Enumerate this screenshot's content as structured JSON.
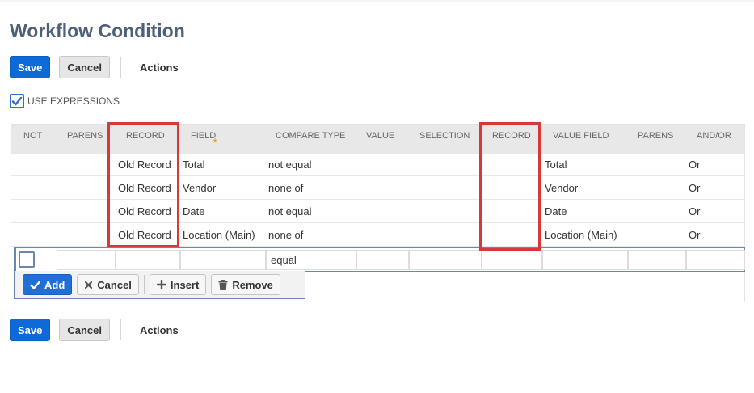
{
  "page": {
    "title": "Workflow Condition"
  },
  "toolbar_top": {
    "save": "Save",
    "cancel": "Cancel",
    "actions": "Actions"
  },
  "toolbar_bottom": {
    "save": "Save",
    "cancel": "Cancel",
    "actions": "Actions"
  },
  "use_expressions": {
    "label": "USE EXPRESSIONS",
    "checked": true
  },
  "grid": {
    "columns": [
      "NOT",
      "PARENS",
      "RECORD",
      "FIELD",
      "COMPARE TYPE",
      "VALUE",
      "SELECTION",
      "RECORD",
      "VALUE FIELD",
      "PARENS",
      "AND/OR"
    ],
    "required_marker": "*",
    "rows": [
      {
        "record": "Old Record",
        "field": "Total",
        "compare": "not equal",
        "value_field": "Total",
        "andor": "Or"
      },
      {
        "record": "Old Record",
        "field": "Vendor",
        "compare": "none of",
        "value_field": "Vendor",
        "andor": "Or"
      },
      {
        "record": "Old Record",
        "field": "Date",
        "compare": "not equal",
        "value_field": "Date",
        "andor": "Or"
      },
      {
        "record": "Old Record",
        "field": "Location (Main)",
        "compare": "none of",
        "value_field": "Location (Main)",
        "andor": "Or"
      }
    ],
    "edit_row": {
      "compare": "equal"
    },
    "buttons": {
      "add": "Add",
      "cancel": "Cancel",
      "insert": "Insert",
      "remove": "Remove"
    }
  },
  "colors": {
    "primary": "#0e6ad8",
    "title": "#4d5f79",
    "highlight": "#d8383a",
    "required": "#e8a11a"
  }
}
